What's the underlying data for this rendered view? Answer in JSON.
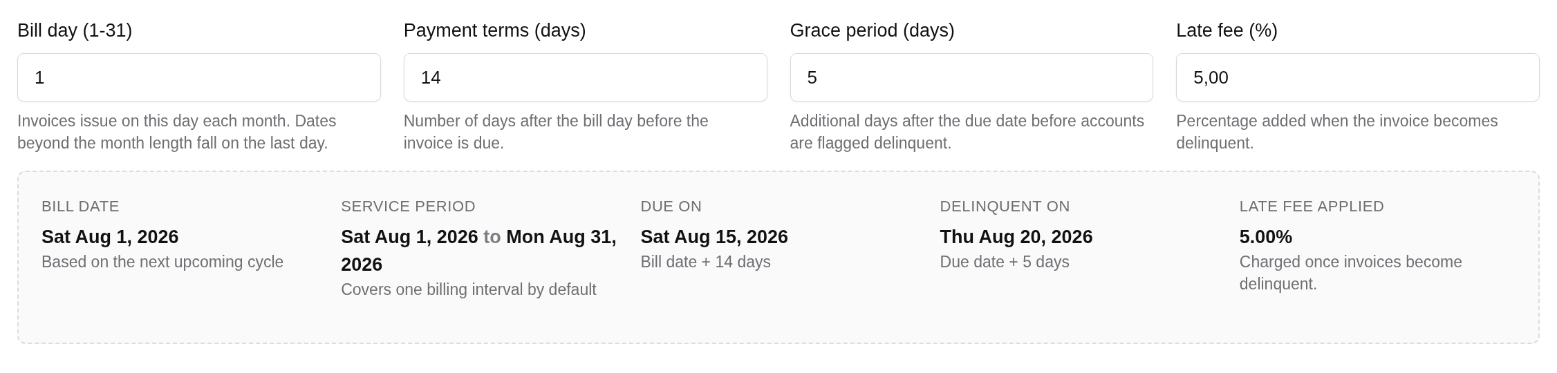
{
  "fields": [
    {
      "label": "Bill day (1-31)",
      "value": "1",
      "help": "Invoices issue on this day each month. Dates beyond the month length fall on the last day."
    },
    {
      "label": "Payment terms (days)",
      "value": "14",
      "help": "Number of days after the bill day before the invoice is due."
    },
    {
      "label": "Grace period (days)",
      "value": "5",
      "help": "Additional days after the due date before accounts are flagged delinquent."
    },
    {
      "label": "Late fee (%)",
      "value": "5,00",
      "help": "Percentage added when the invoice becomes delinquent."
    }
  ],
  "summary": [
    {
      "kind": "single",
      "label": "BILL DATE",
      "value": "Sat Aug 1, 2026",
      "note": "Based on the next upcoming cycle"
    },
    {
      "kind": "range",
      "label": "SERVICE PERIOD",
      "start": "Sat Aug 1, 2026",
      "joiner": "to",
      "end": "Mon Aug 31, 2026",
      "note": "Covers one billing interval by default"
    },
    {
      "kind": "single",
      "label": "DUE ON",
      "value": "Sat Aug 15, 2026",
      "note": "Bill date + 14 days"
    },
    {
      "kind": "single",
      "label": "DELINQUENT ON",
      "value": "Thu Aug 20, 2026",
      "note": "Due date + 5 days"
    },
    {
      "kind": "single",
      "label": "LATE FEE APPLIED",
      "value": "5.00%",
      "note": "Charged once invoices become delinquent."
    }
  ]
}
